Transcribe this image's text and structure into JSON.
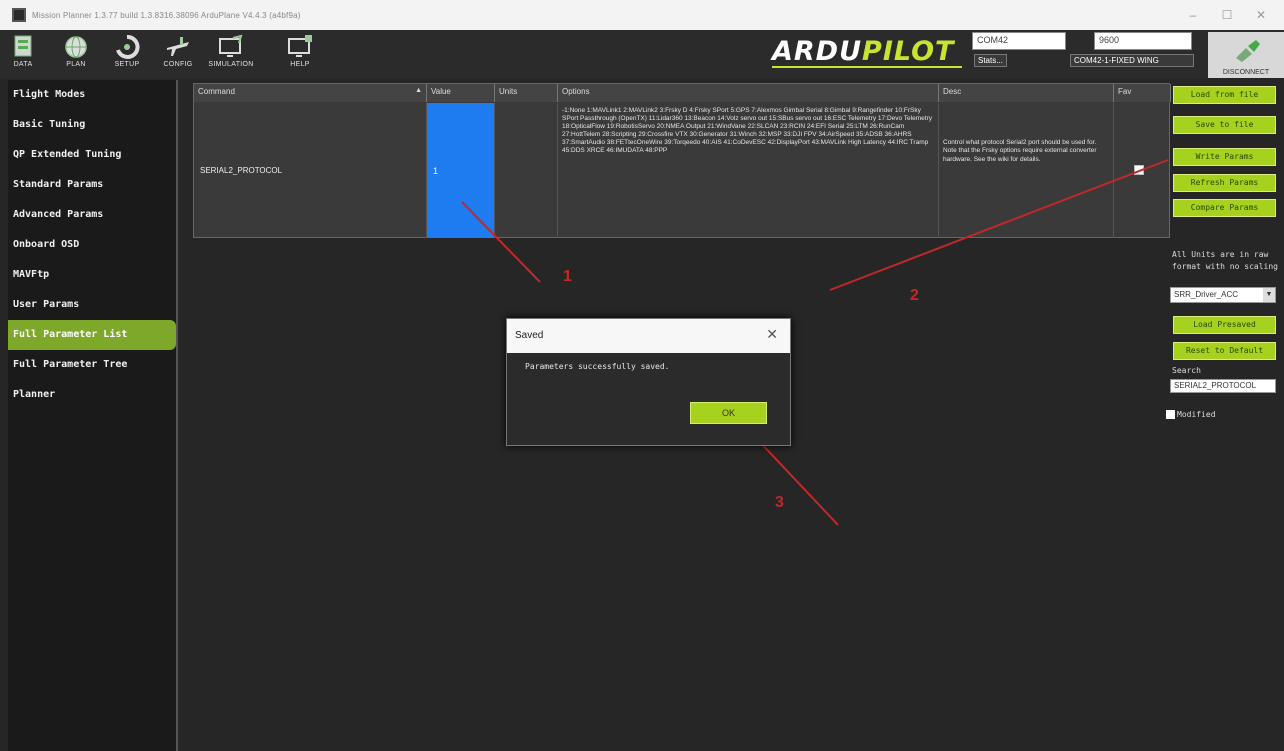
{
  "window": {
    "title": "Mission Planner 1.3.77 build 1.3.8316.38096 ArduPlane V4.4.3 (a4bf9a)",
    "controls": [
      "–",
      "☐",
      "✕"
    ]
  },
  "toolbar": {
    "buttons": [
      {
        "label": "DATA",
        "icon": "data-icon"
      },
      {
        "label": "PLAN",
        "icon": "globe-icon"
      },
      {
        "label": "SETUP",
        "icon": "setup-icon"
      },
      {
        "label": "CONFIG",
        "icon": "plane-wrench-icon"
      },
      {
        "label": "SIMULATION",
        "icon": "simulation-icon"
      },
      {
        "label": "HELP",
        "icon": "help-icon"
      }
    ],
    "logo_part1": "ARDU",
    "logo_part2": "PILOT",
    "port": "COM42",
    "baud": "9600",
    "stats_link": "Stats...",
    "link_status": "COM42-1-FIXED WING",
    "disconnect_label": "DISCONNECT"
  },
  "sidebar": {
    "items": [
      {
        "label": "Flight Modes"
      },
      {
        "label": "Basic Tuning"
      },
      {
        "label": "QP Extended Tuning"
      },
      {
        "label": "Standard Params"
      },
      {
        "label": "Advanced Params"
      },
      {
        "label": "Onboard OSD"
      },
      {
        "label": "MAVFtp"
      },
      {
        "label": "User Params"
      },
      {
        "label": "Full Parameter List",
        "active": true
      },
      {
        "label": "Full Parameter Tree"
      },
      {
        "label": "Planner"
      }
    ]
  },
  "grid": {
    "headers": {
      "command": "Command",
      "value": "Value",
      "units": "Units",
      "options": "Options",
      "desc": "Desc",
      "fav": "Fav"
    },
    "row": {
      "command": "SERIAL2_PROTOCOL",
      "value": "1",
      "units": "",
      "options": "-1:None 1:MAVLink1 2:MAVLink2 3:Frsky D 4:Frsky SPort 5:GPS 7:Alexmos Gimbal Serial 8:Gimbal 9:Rangefinder 10:FrSky SPort Passthrough (OpenTX) 11:Lidar360 13:Beacon 14:Volz servo out 15:SBus servo out 16:ESC Telemetry 17:Devo Telemetry 18:OpticalFlow 19:RobotisServo 20:NMEA Output 21:WindVane 22:SLCAN 23:RCIN 24:EFI Serial 25:LTM 26:RunCam 27:HottTelem 28:Scripting 29:Crossfire VTX 30:Generator 31:Winch 32:MSP 33:DJI FPV 34:AirSpeed 35:ADSB 36:AHRS 37:SmartAudio 38:FETtecOneWire 39:Torqeedo 40:AIS 41:CoDevESC 42:DisplayPort 43:MAVLink High Latency 44:IRC Tramp 45:DDS XRCE 46:IMUDATA 48:PPP",
      "desc": "Control what protocol Serial2 port should be used for. Note that the Frsky options require external converter hardware. See the wiki for details.",
      "favorite": false
    }
  },
  "right_panel": {
    "load_from_file": "Load from file",
    "save_to_file": "Save to file",
    "write_params": "Write Params",
    "refresh_params": "Refresh Params",
    "compare_params": "Compare Params",
    "units_note_1": "All Units are in raw",
    "units_note_2": "format with no scaling",
    "preset_value": "SRR_Driver_ACC",
    "load_presaved": "Load Presaved",
    "reset_default": "Reset to Default",
    "search_label": "Search",
    "search_value": "SERIAL2_PROTOCOL",
    "modified_label": "Modified"
  },
  "dialog": {
    "title": "Saved",
    "close": "✕",
    "message": "Parameters successfully saved.",
    "ok_label": "OK"
  },
  "annotations": {
    "marker1": "1",
    "marker2": "2",
    "marker3": "3",
    "color": "#c12828"
  },
  "colors": {
    "accent": "#a6d11e",
    "selected_value": "#1f7cf0",
    "active_sidebar": "#7da82a"
  }
}
